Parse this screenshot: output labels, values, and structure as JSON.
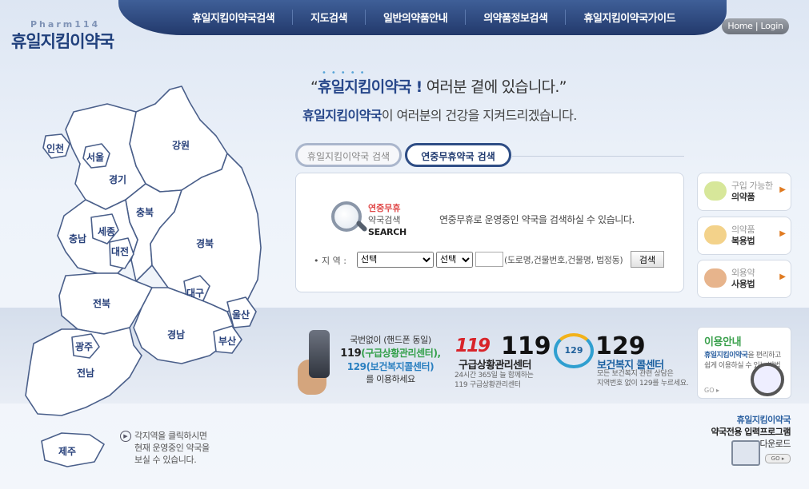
{
  "header": {
    "logo_en": "Pharm114",
    "logo_ko": "휴일지킴이약국",
    "nav": [
      "휴일지킴이약국검색",
      "지도검색",
      "일반의약품안내",
      "의약품정보검색",
      "휴일지킴이약국가이드"
    ],
    "home_login": "Home | Login"
  },
  "slogan": {
    "quote_open": "“",
    "brand": "휴일지킴이약국 !",
    "rest": " 여러분 곁에 있습니다.”",
    "line2_brand": "휴일지킴이약국",
    "line2_rest": "이 여러분의 건강을 지켜드리겠습니다."
  },
  "tabs": [
    "휴일지킴이약국 검색",
    "연중무휴약국 검색"
  ],
  "search": {
    "title_a": "연중무휴",
    "title_b": "약국검색",
    "title_c": "SEARCH",
    "desc": "연중무휴로 운영중인 약국을 검색하실 수 있습니다.",
    "region_label": "• 지 역 :",
    "select1": "선택",
    "select2": "선택",
    "addr_hint": "(도로명,건물번호,건물명, 법정동)",
    "button": "검색"
  },
  "side_menu": [
    {
      "line1": "구입 가능한",
      "line2": "의약품",
      "color": "#d7e79a"
    },
    {
      "line1": "의약품",
      "line2": "복용법",
      "color": "#f3d28a"
    },
    {
      "line1": "외용약",
      "line2": "사용법",
      "color": "#e7b48c"
    }
  ],
  "map": {
    "regions": [
      "인천",
      "서울",
      "경기",
      "강원",
      "충북",
      "충남",
      "세종",
      "대전",
      "경북",
      "대구",
      "전북",
      "울산",
      "경남",
      "광주",
      "부산",
      "전남",
      "제주"
    ],
    "tip": [
      "각지역을 클릭하시면",
      "현재 운영중인 약국을",
      "보실 수 있습니다."
    ]
  },
  "phone": {
    "line1": "국번없이 (핸드폰 동일)",
    "line2_num": "119",
    "line2_rest": "(구급상황관리센터),",
    "line3": "129(보건복지콜센터)",
    "line4": "를 이용하세요"
  },
  "c119": {
    "logo": "119",
    "num": "119",
    "title": "구급상황관리센터",
    "desc1": "24시간 365일 늘 함께하는",
    "desc2": "119 구급상황관리센터"
  },
  "c129": {
    "logo": "129",
    "num": "129",
    "title": "보건복지 콜센터",
    "desc1": "모든 보건복지 관련 상담은",
    "desc2": "지역번호 없이 129를 누르세요."
  },
  "guide": {
    "title": "이용안내",
    "brand": "휴일지킴이약국",
    "desc_rest": "을 편리하고 쉽게 이용하실 수 있는 방법",
    "go": "GO ▸"
  },
  "program": {
    "line1": "휴일지킴이약국",
    "line2": "약국전용 입력프로그램",
    "line3": "다운로드",
    "go": "GO ▸"
  }
}
